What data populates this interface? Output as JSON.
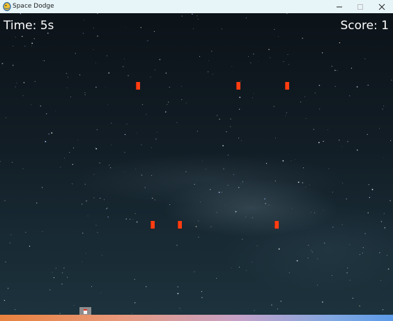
{
  "window": {
    "title": "Space Dodge",
    "icon": "pygame-snake-icon",
    "controls": [
      "minimize-icon",
      "maximize-icon",
      "close-icon"
    ]
  },
  "hud": {
    "time_label": "Time: 5s",
    "score_label": "Score: 1"
  },
  "colors": {
    "projectile": "#ff3d12",
    "player_body": "#8c8c8c",
    "text": "#ffffff",
    "titlebar": "#e7f5f9"
  },
  "projectiles": {
    "row_top": {
      "count": 3
    },
    "row_middle": {
      "count": 3
    }
  }
}
